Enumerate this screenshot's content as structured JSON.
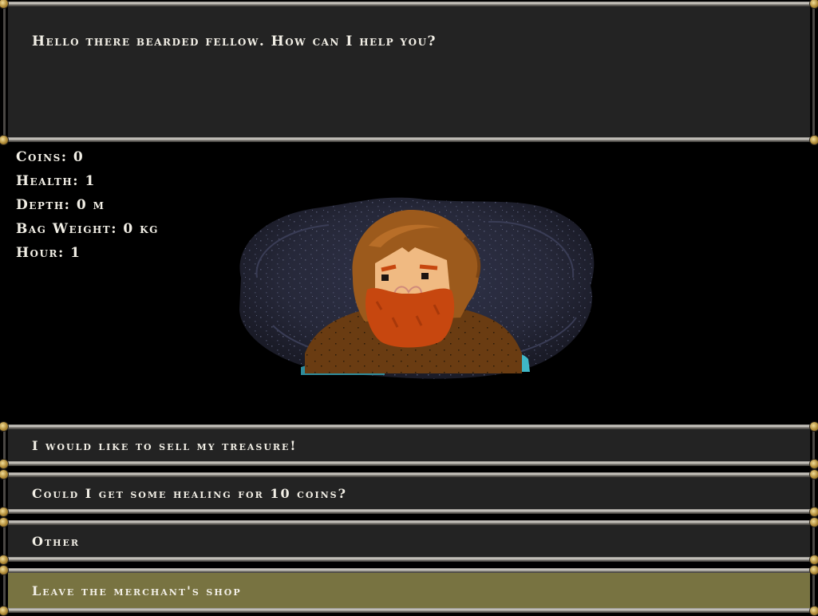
{
  "dialog": {
    "text": "Hello there bearded fellow. How can I help you?"
  },
  "stats": {
    "coins": "Coins: 0",
    "health": "Health: 1",
    "depth": "Depth: 0 m",
    "bag_weight": "Bag Weight: 0 kg",
    "hour": "Hour: 1"
  },
  "options": [
    {
      "label": "I would like to sell my treasure!"
    },
    {
      "label": "Could I get some healing for 10 coins?"
    },
    {
      "label": "Other"
    },
    {
      "label": "Leave the merchant's shop",
      "selected": true
    }
  ],
  "portrait": {
    "subject": "merchant-portrait"
  },
  "colors": {
    "background": "#000000",
    "panel": "#232323",
    "highlight": "#787341",
    "text": "#f2efe6",
    "rivet": "#b08a36",
    "hood": "#9c5a1c",
    "beard": "#c7470f",
    "skin": "#f0ba82",
    "cave": "#2b2d40",
    "water": "#3fb7c7"
  }
}
